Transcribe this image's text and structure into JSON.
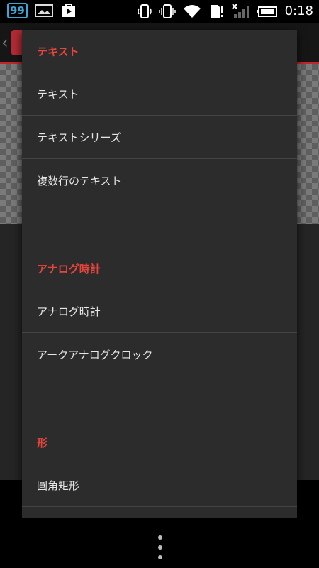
{
  "status_bar": {
    "notification_badge": "99",
    "time": "0:18",
    "icons": [
      "image-icon",
      "play-store-icon",
      "phone-icon",
      "vibrate-icon",
      "wifi-icon",
      "sd-card-icon",
      "signal-icon",
      "battery-icon"
    ]
  },
  "menu": {
    "sections": [
      {
        "header": "テキスト",
        "items": [
          "テキスト",
          "テキストシリーズ",
          "複数行のテキスト"
        ]
      },
      {
        "header": "アナログ時計",
        "items": [
          "アナログ時計",
          "アークアナログクロック"
        ]
      },
      {
        "header": "形",
        "items": [
          "圓角矩形"
        ]
      }
    ]
  },
  "colors": {
    "accent": "#e8453c",
    "menu_bg": "#2c2c2c",
    "status_badge": "#3aa6d6"
  }
}
